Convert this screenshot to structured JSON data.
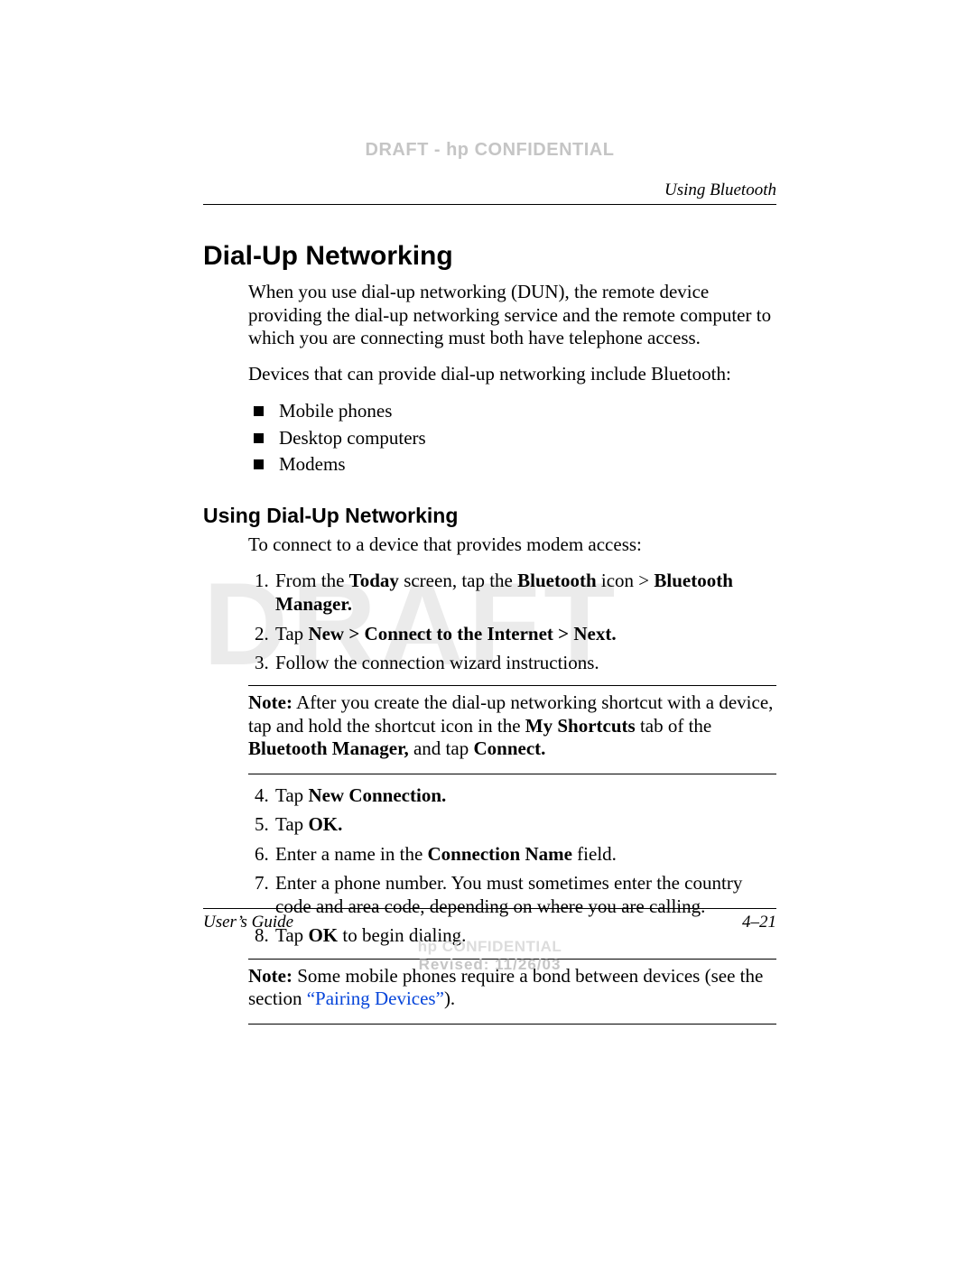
{
  "header": {
    "confidential": "DRAFT - hp CONFIDENTIAL",
    "running": "Using Bluetooth",
    "watermark": "DRAFT"
  },
  "h1": "Dial-Up Networking",
  "intro_p1": "When you use dial-up networking (DUN), the remote device providing the dial-up networking service and the remote computer to which you are connecting must both have telephone access.",
  "intro_p2": "Devices that can provide dial-up networking include Bluetooth:",
  "bullets": [
    "Mobile phones",
    "Desktop computers",
    "Modems"
  ],
  "h2": "Using Dial-Up Networking",
  "lead2": "To connect to a device that provides modem access:",
  "step1": {
    "pre": "From the ",
    "b1": "Today",
    "mid1": " screen, tap the ",
    "b2": "Bluetooth",
    "mid2": " icon > ",
    "b3": "Bluetooth Manager."
  },
  "step2": {
    "pre": "Tap ",
    "b": "New > Connect to the Internet > Next."
  },
  "step3": "Follow the connection wizard instructions.",
  "note1": {
    "label": "Note:",
    "t1": " After you create the dial-up networking shortcut with a device, tap and hold the shortcut icon in the ",
    "b1": "My Shortcuts",
    "t2": " tab of the ",
    "b2": "Bluetooth Manager,",
    "t3": " and tap ",
    "b3": "Connect."
  },
  "step4": {
    "pre": "Tap ",
    "b": "New Connection."
  },
  "step5": {
    "pre": "Tap ",
    "b": "OK."
  },
  "step6": {
    "pre": "Enter a name in the ",
    "b": "Connection Name",
    "post": " field."
  },
  "step7": "Enter a phone number. You must sometimes enter the country code and area code, depending on where you are calling.",
  "step8": {
    "pre": "Tap ",
    "b": "OK",
    "post": " to begin dialing."
  },
  "note2": {
    "label": "Note:",
    "t1": " Some mobile phones require a bond between devices (see the section ",
    "link": "“Pairing Devices”",
    "t2": ")."
  },
  "footer": {
    "left": "User’s Guide",
    "right": "4–21",
    "conf": "hp CONFIDENTIAL",
    "rev": "Revised: 11/26/03"
  }
}
